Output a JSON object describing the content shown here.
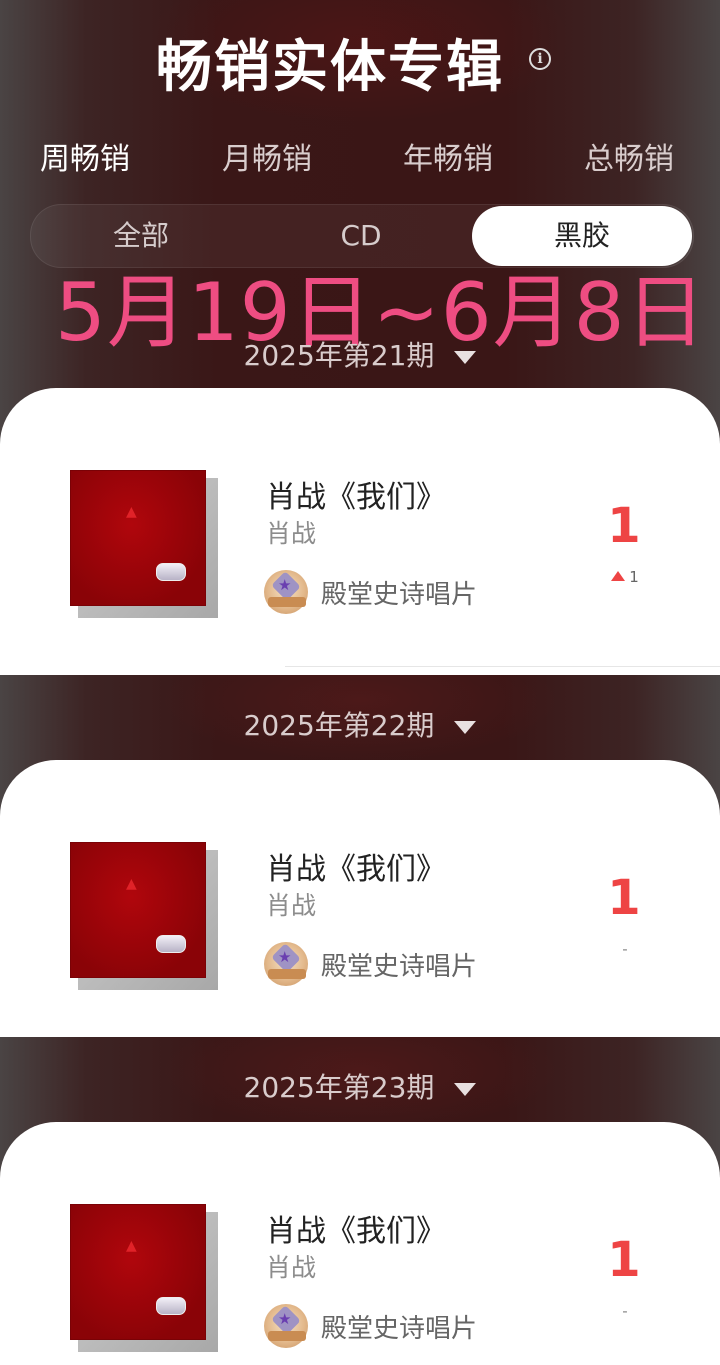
{
  "header": {
    "title": "畅销实体专辑",
    "info_icon": "i"
  },
  "tabs": [
    "周畅销",
    "月畅销",
    "年畅销",
    "总畅销"
  ],
  "active_tab": "周畅销",
  "segments": [
    "全部",
    "CD",
    "黑胶"
  ],
  "active_segment": "黑胶",
  "overlay_text": "5月19日~6月8日",
  "colors": {
    "accent_red": "#ee4444",
    "overlay_pink": "#ee4d82",
    "background_dark": "#3a1616"
  },
  "periods": [
    {
      "label": "2025年第21期",
      "entries": [
        {
          "title": "肖战《我们》",
          "artist": "肖战",
          "tag": "殿堂史诗唱片",
          "rank": "1",
          "change_dir": "up",
          "change_value": "1",
          "icon": "medal-icon"
        }
      ]
    },
    {
      "label": "2025年第22期",
      "entries": [
        {
          "title": "肖战《我们》",
          "artist": "肖战",
          "tag": "殿堂史诗唱片",
          "rank": "1",
          "change_dir": "none",
          "change_value": "-",
          "icon": "medal-icon"
        }
      ]
    },
    {
      "label": "2025年第23期",
      "entries": [
        {
          "title": "肖战《我们》",
          "artist": "肖战",
          "tag": "殿堂史诗唱片",
          "rank": "1",
          "change_dir": "none",
          "change_value": "-",
          "icon": "medal-icon"
        }
      ]
    }
  ]
}
